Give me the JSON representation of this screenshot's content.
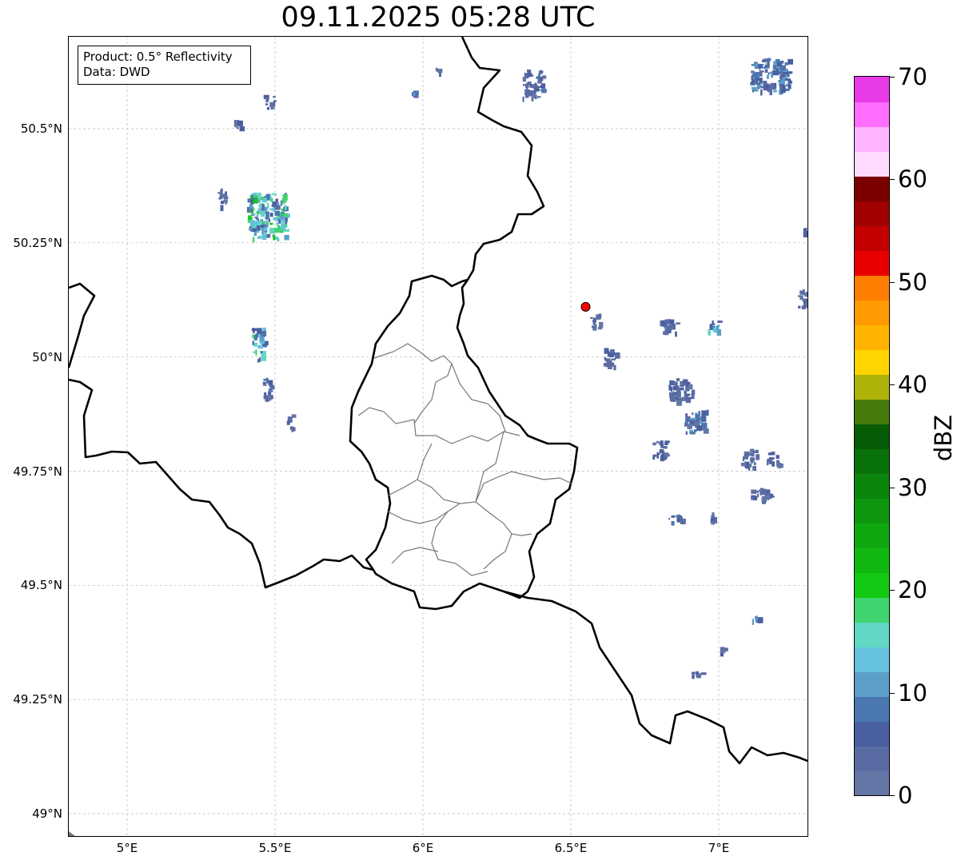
{
  "title": "09.11.2025 05:28 UTC",
  "info_box": {
    "line1": "Product: 0.5° Reflectivity",
    "line2": "Data: DWD"
  },
  "axes": {
    "lat_labels": [
      {
        "text": "50.5°N",
        "lat": 50.5
      },
      {
        "text": "50.25°N",
        "lat": 50.25
      },
      {
        "text": "50°N",
        "lat": 50.0
      },
      {
        "text": "49.75°N",
        "lat": 49.75
      },
      {
        "text": "49.5°N",
        "lat": 49.5
      },
      {
        "text": "49.25°N",
        "lat": 49.25
      },
      {
        "text": "49°N",
        "lat": 49.0
      }
    ],
    "lon_labels": [
      {
        "text": "5°E",
        "lon": 5.0
      },
      {
        "text": "5.5°E",
        "lon": 5.5
      },
      {
        "text": "6°E",
        "lon": 6.0
      },
      {
        "text": "6.5°E",
        "lon": 6.5
      },
      {
        "text": "7°E",
        "lon": 7.0
      }
    ],
    "lat_range": [
      48.95,
      50.7
    ],
    "lon_range": [
      4.8,
      7.3
    ],
    "grid": true
  },
  "radar_site": {
    "lon": 6.55,
    "lat": 50.11,
    "color": "#ff0000"
  },
  "colorbar": {
    "label": "dBZ",
    "min": 0,
    "max": 70,
    "ticks": [
      {
        "text": "0",
        "value": 0
      },
      {
        "text": "10",
        "value": 10
      },
      {
        "text": "20",
        "value": 20
      },
      {
        "text": "30",
        "value": 30
      },
      {
        "text": "40",
        "value": 40
      },
      {
        "text": "50",
        "value": 50
      },
      {
        "text": "60",
        "value": 60
      },
      {
        "text": "70",
        "value": 70
      }
    ],
    "colors": [
      "#6476a6",
      "#5a6ca3",
      "#4a5fa0",
      "#4a77b0",
      "#5b9fc8",
      "#65c2dc",
      "#60d8c4",
      "#3fd46e",
      "#13c913",
      "#12b812",
      "#10a810",
      "#0f960f",
      "#0c850c",
      "#0a720a",
      "#075c07",
      "#467a0b",
      "#aeb30a",
      "#ffd400",
      "#ffb300",
      "#ff9a00",
      "#ff7d00",
      "#e80000",
      "#c20000",
      "#a00000",
      "#7a0000",
      "#ffdcff",
      "#ffb4ff",
      "#ff6efe",
      "#e93ae9"
    ]
  },
  "echoes": [
    {
      "lon": 5.47,
      "lat": 50.31,
      "size": [
        0.13,
        0.1
      ],
      "dbz": 20
    },
    {
      "lon": 5.44,
      "lat": 50.03,
      "size": [
        0.04,
        0.07
      ],
      "dbz": 18
    },
    {
      "lon": 5.47,
      "lat": 49.93,
      "size": [
        0.03,
        0.05
      ],
      "dbz": 8
    },
    {
      "lon": 5.55,
      "lat": 49.86,
      "size": [
        0.02,
        0.03
      ],
      "dbz": 6
    },
    {
      "lon": 5.48,
      "lat": 50.56,
      "size": [
        0.04,
        0.03
      ],
      "dbz": 8
    },
    {
      "lon": 5.37,
      "lat": 50.51,
      "size": [
        0.02,
        0.02
      ],
      "dbz": 7
    },
    {
      "lon": 5.32,
      "lat": 50.35,
      "size": [
        0.03,
        0.04
      ],
      "dbz": 6
    },
    {
      "lon": 5.97,
      "lat": 50.58,
      "size": [
        0.02,
        0.01
      ],
      "dbz": 12
    },
    {
      "lon": 6.05,
      "lat": 50.63,
      "size": [
        0.02,
        0.01
      ],
      "dbz": 6
    },
    {
      "lon": 6.37,
      "lat": 50.6,
      "size": [
        0.07,
        0.06
      ],
      "dbz": 8
    },
    {
      "lon": 7.17,
      "lat": 50.62,
      "size": [
        0.13,
        0.07
      ],
      "dbz": 12
    },
    {
      "lon": 7.29,
      "lat": 50.28,
      "size": [
        0.02,
        0.02
      ],
      "dbz": 6
    },
    {
      "lon": 7.28,
      "lat": 50.13,
      "size": [
        0.03,
        0.04
      ],
      "dbz": 7
    },
    {
      "lon": 6.83,
      "lat": 50.07,
      "size": [
        0.06,
        0.03
      ],
      "dbz": 8
    },
    {
      "lon": 6.98,
      "lat": 50.07,
      "size": [
        0.04,
        0.03
      ],
      "dbz": 18
    },
    {
      "lon": 6.63,
      "lat": 50.0,
      "size": [
        0.04,
        0.04
      ],
      "dbz": 6
    },
    {
      "lon": 6.87,
      "lat": 49.93,
      "size": [
        0.08,
        0.05
      ],
      "dbz": 7
    },
    {
      "lon": 6.92,
      "lat": 49.86,
      "size": [
        0.08,
        0.05
      ],
      "dbz": 10
    },
    {
      "lon": 6.8,
      "lat": 49.8,
      "size": [
        0.05,
        0.04
      ],
      "dbz": 7
    },
    {
      "lon": 7.1,
      "lat": 49.78,
      "size": [
        0.05,
        0.04
      ],
      "dbz": 6
    },
    {
      "lon": 7.18,
      "lat": 49.78,
      "size": [
        0.04,
        0.03
      ],
      "dbz": 7
    },
    {
      "lon": 7.14,
      "lat": 49.7,
      "size": [
        0.07,
        0.03
      ],
      "dbz": 7
    },
    {
      "lon": 6.85,
      "lat": 49.65,
      "size": [
        0.05,
        0.02
      ],
      "dbz": 8
    },
    {
      "lon": 6.98,
      "lat": 49.65,
      "size": [
        0.02,
        0.02
      ],
      "dbz": 6
    },
    {
      "lon": 7.12,
      "lat": 49.43,
      "size": [
        0.04,
        0.01
      ],
      "dbz": 12
    },
    {
      "lon": 7.01,
      "lat": 49.36,
      "size": [
        0.03,
        0.01
      ],
      "dbz": 6
    },
    {
      "lon": 6.92,
      "lat": 49.31,
      "size": [
        0.04,
        0.01
      ],
      "dbz": 7
    },
    {
      "lon": 6.58,
      "lat": 50.08,
      "size": [
        0.03,
        0.03
      ],
      "dbz": 6
    }
  ]
}
